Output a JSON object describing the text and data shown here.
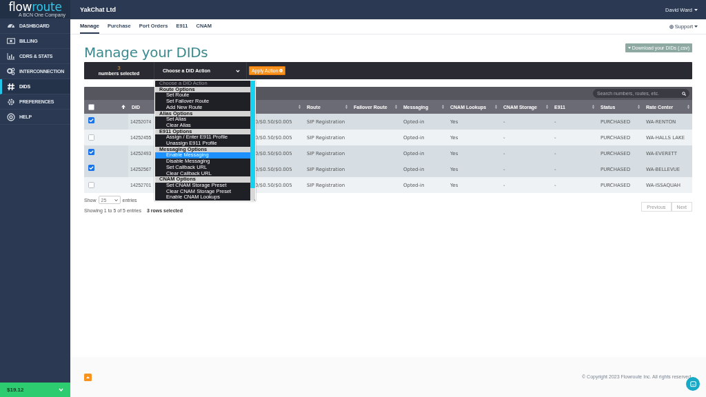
{
  "brand": {
    "primary": "flow",
    "accent": "route",
    "tagline": "A BCN One Company"
  },
  "sidebar": {
    "items": [
      {
        "label": "DASHBOARD",
        "selected": false
      },
      {
        "label": "BILLING",
        "selected": false
      },
      {
        "label": "CDRS & STATS",
        "selected": false
      },
      {
        "label": "INTERCONNECTION",
        "selected": false
      },
      {
        "label": "DIDS",
        "selected": true
      },
      {
        "label": "PREFERENCES",
        "selected": false
      },
      {
        "label": "HELP",
        "selected": false
      }
    ],
    "balance": "$19.12"
  },
  "topbar": {
    "account": "YakChat Ltd",
    "user": "David Ward"
  },
  "tabs": [
    {
      "label": "Manage",
      "selected": true
    },
    {
      "label": "Purchase",
      "selected": false
    },
    {
      "label": "Port Orders",
      "selected": false
    },
    {
      "label": "E911",
      "selected": false
    },
    {
      "label": "CNAM",
      "selected": false
    }
  ],
  "support": "Support",
  "page_title": "Manage your DIDs",
  "download_button": "Download your DIDs (.csv)",
  "action_bar": {
    "count": "3",
    "count_label": "numbers selected",
    "select_value": "Choose a DID Action",
    "apply_button": "Apply Action"
  },
  "dropdown": {
    "placeholder": "Choose a DID Action",
    "groups": [
      {
        "label": "Route Options",
        "options": [
          {
            "label": "Set Route",
            "selected": false
          },
          {
            "label": "Set Failover Route",
            "selected": false
          },
          {
            "label": "Add New Route",
            "selected": false
          }
        ]
      },
      {
        "label": "Alias Options",
        "options": [
          {
            "label": "Set Alias",
            "selected": false
          },
          {
            "label": "Clear Alias",
            "selected": false
          }
        ]
      },
      {
        "label": "E911 Options",
        "options": [
          {
            "label": "Assign / Enter E911 Profile",
            "selected": false
          },
          {
            "label": "Unassign E911 Profile",
            "selected": false
          }
        ]
      },
      {
        "label": "Messaging Options",
        "options": [
          {
            "label": "Enable Messaging",
            "selected": true
          },
          {
            "label": "Disable Messaging",
            "selected": false
          },
          {
            "label": "Set Callback URL",
            "selected": false
          },
          {
            "label": "Clear Callback URL",
            "selected": false
          }
        ]
      },
      {
        "label": "CNAM Options",
        "options": [
          {
            "label": "Set CNAM Storage Preset",
            "selected": false
          },
          {
            "label": "Clear CNAM Storage Preset",
            "selected": false
          },
          {
            "label": "Enable CNAM Lookups",
            "selected": false
          }
        ]
      }
    ]
  },
  "table": {
    "search_placeholder": "Search numbers, routes, etc.",
    "select_all_checked": false,
    "columns": [
      {
        "kind": "text",
        "label": "DID"
      },
      {
        "kind": "covered"
      },
      {
        "kind": "text",
        "label": "Route"
      },
      {
        "kind": "text",
        "label": "Failover Route"
      },
      {
        "kind": "text",
        "label": "Messaging"
      },
      {
        "kind": "text",
        "label": "CNAM Lookups"
      },
      {
        "kind": "text",
        "label": "CNAM Storage"
      },
      {
        "kind": "text",
        "label": "E911"
      },
      {
        "kind": "text",
        "label": "Status"
      },
      {
        "kind": "text",
        "label": "Rate Center"
      }
    ],
    "rows": [
      {
        "checked": true,
        "did": "14252074",
        "column_3": "0/$0.50/$0.005",
        "route": "SIP Registration",
        "messaging": "Opted-in",
        "cnam_lookups": "Yes",
        "cnam_storage": "-",
        "e911": "-",
        "status": "PURCHASED",
        "rate_center": "WA-RENTON"
      },
      {
        "checked": false,
        "did": "14252455",
        "column_3": "0/$0.50/$0.005",
        "route": "SIP Registration",
        "messaging": "Opted-in",
        "cnam_lookups": "Yes",
        "cnam_storage": "-",
        "e911": "-",
        "status": "PURCHASED",
        "rate_center": "WA-HALLS LAKE"
      },
      {
        "checked": true,
        "did": "14252493",
        "column_3": "0/$0.50/$0.005",
        "route": "SIP Registration",
        "messaging": "Opted-in",
        "cnam_lookups": "Yes",
        "cnam_storage": "-",
        "e911": "-",
        "status": "PURCHASED",
        "rate_center": "WA-EVERETT"
      },
      {
        "checked": true,
        "did": "14252567",
        "column_3": "0/$0.50/$0.005",
        "route": "SIP Registration",
        "messaging": "Opted-in",
        "cnam_lookups": "Yes",
        "cnam_storage": "-",
        "e911": "-",
        "status": "PURCHASED",
        "rate_center": "WA-BELLEVUE"
      },
      {
        "checked": false,
        "did": "14252701",
        "column_3": "0/$0.50/$0.005",
        "route": "SIP Registration",
        "messaging": "Opted-in",
        "cnam_lookups": "Yes",
        "cnam_storage": "-",
        "e911": "-",
        "status": "PURCHASED",
        "rate_center": "WA-ISSAQUAH"
      }
    ],
    "length_label_before": "Show",
    "length_value": "25",
    "length_label_after": "entries",
    "info": "Showing 1 to 5 of 5 entries",
    "selection_info": "3 rows selected",
    "pagination": [
      {
        "label": "Previous",
        "disabled": true
      },
      {
        "label": "Next",
        "disabled": true
      }
    ]
  },
  "footer": {
    "copyright": "© Copyright 2023 Flowroute Inc. All rights reserved."
  }
}
